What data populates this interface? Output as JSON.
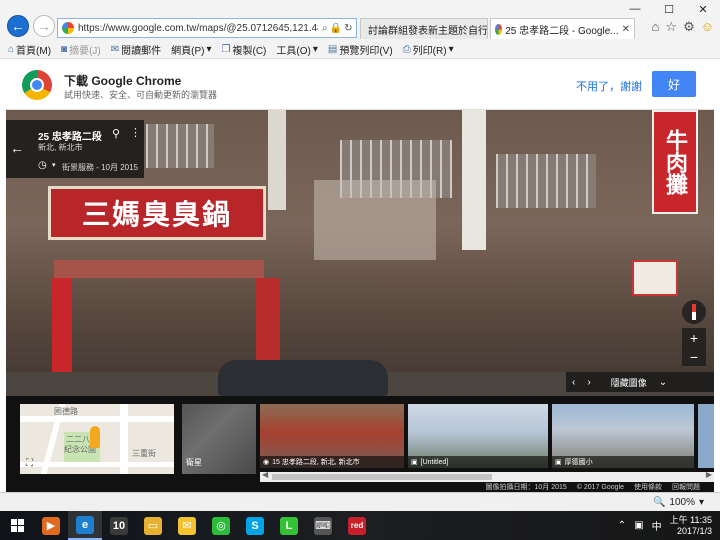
{
  "browser": {
    "url": "https://www.google.com.tw/maps/@25.0712645,121.4864",
    "tabs": [
      {
        "label": "討論群組發表新主題於自行..."
      },
      {
        "label": "25 忠孝路二段 - Google..."
      }
    ],
    "window_controls": {
      "minimize": "—",
      "maximize": "☐",
      "close": "✕"
    }
  },
  "command_bar": {
    "items": [
      {
        "label": "首頁(M)",
        "icon": "home-icon"
      },
      {
        "label": "摘要(J)",
        "icon": "rss-icon",
        "disabled": true
      },
      {
        "label": "閱讀郵件",
        "icon": "mail-icon"
      },
      {
        "label": "網頁(P)",
        "icon": "page-icon"
      },
      {
        "label": "複製(C)",
        "icon": "copy-icon"
      },
      {
        "label": "工具(O)",
        "icon": "tools-icon"
      },
      {
        "label": "預覽列印(V)",
        "icon": "print-preview-icon"
      },
      {
        "label": "列印(R)",
        "icon": "print-icon"
      }
    ]
  },
  "promo": {
    "title": "下載 Google Chrome",
    "subtitle": "試用快速、安全、可自動更新的瀏覽器",
    "dismiss_label": "不用了，謝謝",
    "accept_label": "好"
  },
  "streetview": {
    "address_line1": "25 忠孝路二段",
    "address_line2": "新北, 新北市",
    "capture_date": "街景服務 - 10月 2015",
    "sign_main": "三媽臭臭鍋",
    "sign_vertical": "牛肉攤",
    "hide_images_label": "隱藏圖像",
    "zoom_in": "+",
    "zoom_out": "−"
  },
  "filmstrip": {
    "map_labels": [
      "國德路",
      "二二八",
      "紀念公園",
      "三重街"
    ],
    "satellite_label": "衛星",
    "thumbnails": [
      {
        "caption": "15 忠孝路二段, 新北, 新北市"
      },
      {
        "caption": "[Untitled]"
      },
      {
        "caption": "厚德國小"
      }
    ]
  },
  "credits": {
    "image_date": "圖像拍攝日期：10月 2015",
    "copyright": "© 2017 Google",
    "terms": "使用條款",
    "report": "回報問題"
  },
  "status": {
    "zoom": "100%"
  },
  "taskbar": {
    "time": "上午 11:35",
    "date": "2017/1/3",
    "apps": [
      {
        "name": "media-player",
        "color": "#e06a20",
        "glyph": "▶"
      },
      {
        "name": "internet-explorer",
        "color": "#1e7fd0",
        "glyph": "e"
      },
      {
        "name": "app-10",
        "color": "#3a3a3a",
        "glyph": "10"
      },
      {
        "name": "file-explorer",
        "color": "#e8b030",
        "glyph": "▭"
      },
      {
        "name": "photo-app",
        "color": "#f2c230",
        "glyph": "✉"
      },
      {
        "name": "wechat",
        "color": "#2dbb3a",
        "glyph": "◎"
      },
      {
        "name": "skype",
        "color": "#00a4e6",
        "glyph": "S"
      },
      {
        "name": "line",
        "color": "#36c236",
        "glyph": "L"
      },
      {
        "name": "keyboard-app",
        "color": "#555",
        "glyph": "⌨"
      },
      {
        "name": "red-app",
        "color": "#c8202a",
        "glyph": "red"
      }
    ]
  }
}
